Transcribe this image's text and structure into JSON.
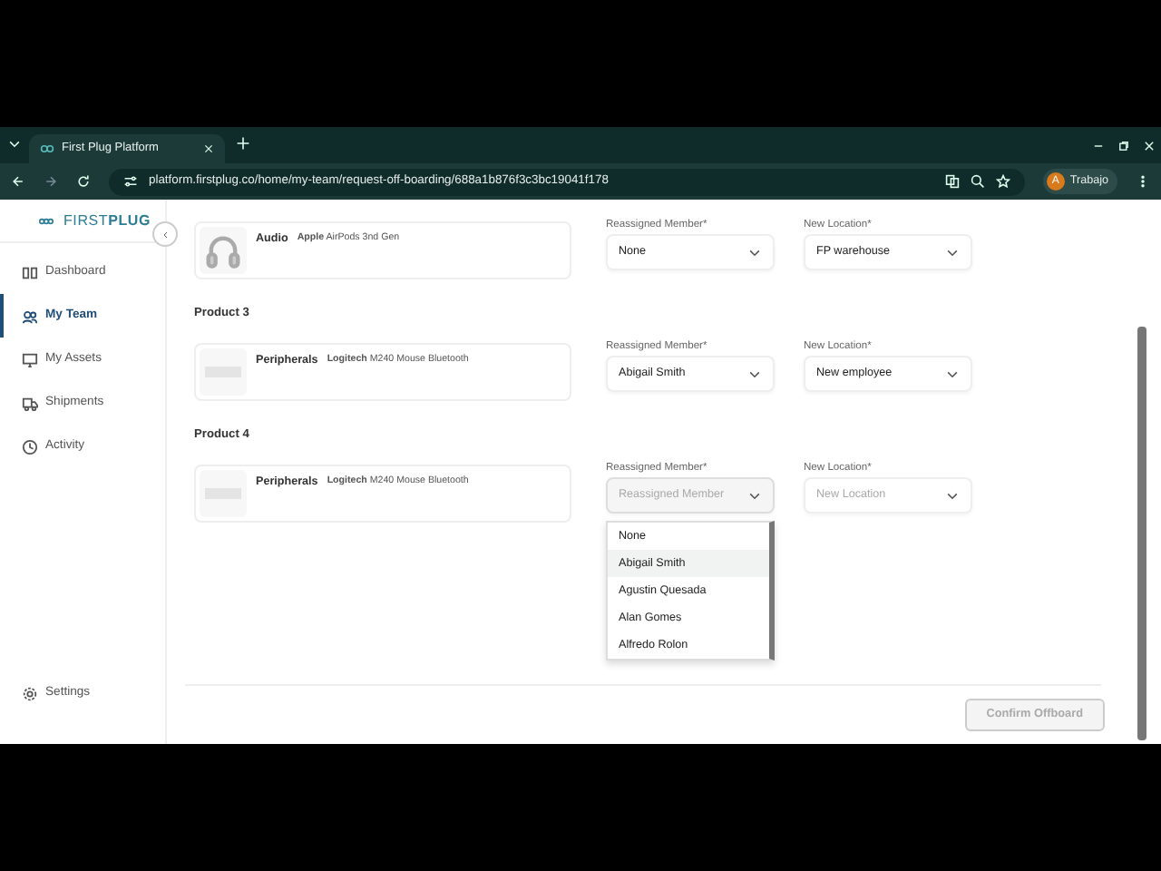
{
  "browser": {
    "tab_title": "First Plug Platform",
    "url": "platform.firstplug.co/home/my-team/request-off-boarding/688a1b876f3c3bc19041f178",
    "profile_initial": "A",
    "profile_name": "Trabajo"
  },
  "sidebar": {
    "logo": "FIRST**PLUG**",
    "items": [
      {
        "label": "Dashboard",
        "selected": false
      },
      {
        "label": "My Team",
        "selected": true
      },
      {
        "label": "My Assets",
        "selected": false
      },
      {
        "label": "Shipments",
        "selected": false
      },
      {
        "label": "Activity",
        "selected": false
      }
    ],
    "settings": "Settings"
  },
  "products": [
    {
      "category": "Audio",
      "brand": "Apple",
      "model": "AirPods 3nd Gen",
      "kind": "audio",
      "member_label": "Reassigned Member*",
      "member": {
        "value": "None"
      },
      "location_label": "New Location*",
      "location": {
        "value": "FP warehouse"
      }
    },
    {
      "heading": "Product 3",
      "category": "Peripherals",
      "brand": "Logitech",
      "model": "M240 Mouse Bluetooth",
      "kind": "peripheral",
      "member_label": "Reassigned Member*",
      "member": {
        "value": "Abigail Smith"
      },
      "location_label": "New Location*",
      "location": {
        "value": "New employee"
      }
    },
    {
      "heading": "Product 4",
      "category": "Peripherals",
      "brand": "Logitech",
      "model": "M240 Mouse Bluetooth",
      "kind": "peripheral",
      "member_label": "Reassigned Member*",
      "member": {
        "placeholder": "Reassigned Member",
        "open": true
      },
      "location_label": "New Location*",
      "location": {
        "placeholder": "New Location"
      }
    }
  ],
  "dropdown": [
    {
      "label": "None",
      "selected": false
    },
    {
      "label": "Abigail Smith",
      "selected": true
    },
    {
      "label": "Agustin Quesada",
      "selected": false
    },
    {
      "label": "Alan Gomes",
      "selected": false
    },
    {
      "label": "Alfredo Rolon",
      "selected": false
    }
  ],
  "confirm_button": {
    "label": "Confirm Offboard",
    "disabled": true
  }
}
